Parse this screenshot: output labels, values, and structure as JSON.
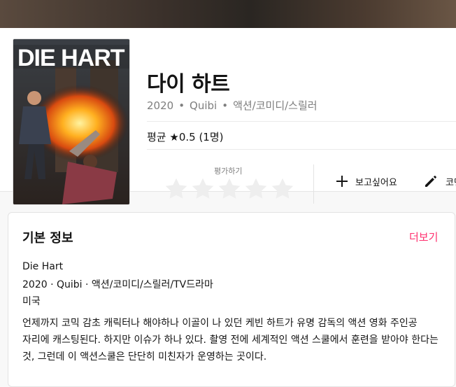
{
  "movie": {
    "title": "다이 하트",
    "year": "2020",
    "platform": "Quibi",
    "genres": "액션/코미디/스릴러",
    "average_rating_label": "평균 ★0.5 (1명)",
    "poster_title": "DIE HART"
  },
  "actions": {
    "rate_label": "평가하기",
    "star_count": 5,
    "want_label": "보고싶어요",
    "comment_label": "코멘트",
    "want_icon": "plus-icon",
    "comment_icon": "pencil-icon"
  },
  "info": {
    "section_title": "기본 정보",
    "more_label": "더보기",
    "original_title": "Die Hart",
    "meta_line": "2020 · Quibi · 액션/코미디/스릴러/TV드라마",
    "country": "미국",
    "synopsis": "언제까지 코믹 감초 캐릭터나 해야하나 이골이 나 있던 케빈 하트가 유명 감독의 액션 영화 주인공 자리에 캐스팅된다. 하지만 이슈가 하나 있다. 촬영 전에 세계적인 액션 스쿨에서 훈련을 받아야 한다는 것, 그런데 이 액션스쿨은 단단히 미친자가 운영하는 곳이다."
  },
  "colors": {
    "accent": "#ff2f6e",
    "star_empty": "#eeeeee",
    "text": "#141414",
    "muted": "#7e7e7e"
  }
}
